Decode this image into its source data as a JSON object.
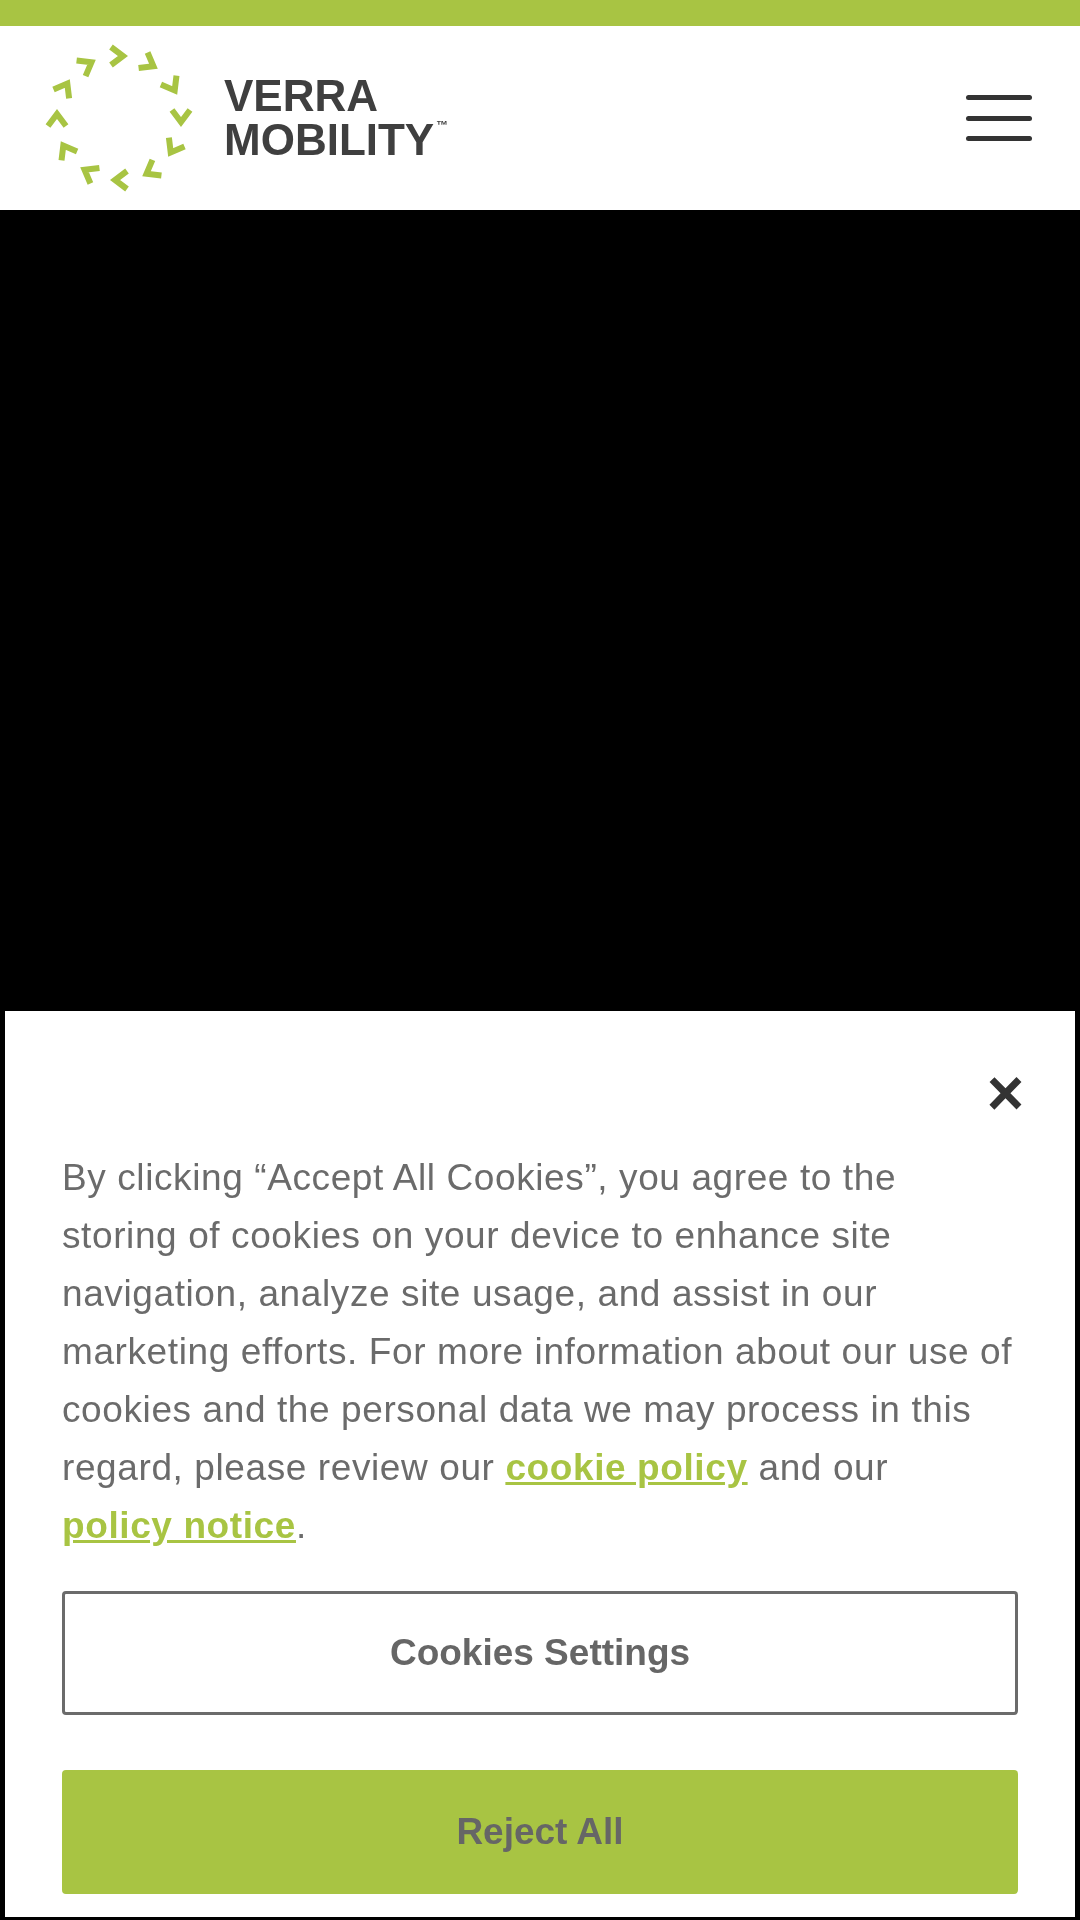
{
  "header": {
    "logo": {
      "line_1": "VERRA",
      "line_2": "MOBILITY",
      "mark": "™"
    },
    "menu": {
      "expanded": false
    }
  },
  "cookie_banner": {
    "close_label": "×",
    "text_before": "By clicking “Accept All Cookies”, you agree to the storing of cookies on your device to enhance site navigation, analyze site usage, and assist in our marketing efforts. For more information about our use of cookies and the personal data we may process in this regard, please review our ",
    "link_1": "cookie policy",
    "text_middle": " and our ",
    "link_2": "policy notice",
    "text_after": ".",
    "buttons": [
      {
        "label": "Cookies Settings",
        "kind": "outline"
      },
      {
        "label": "Reject All",
        "kind": "filled"
      }
    ]
  }
}
